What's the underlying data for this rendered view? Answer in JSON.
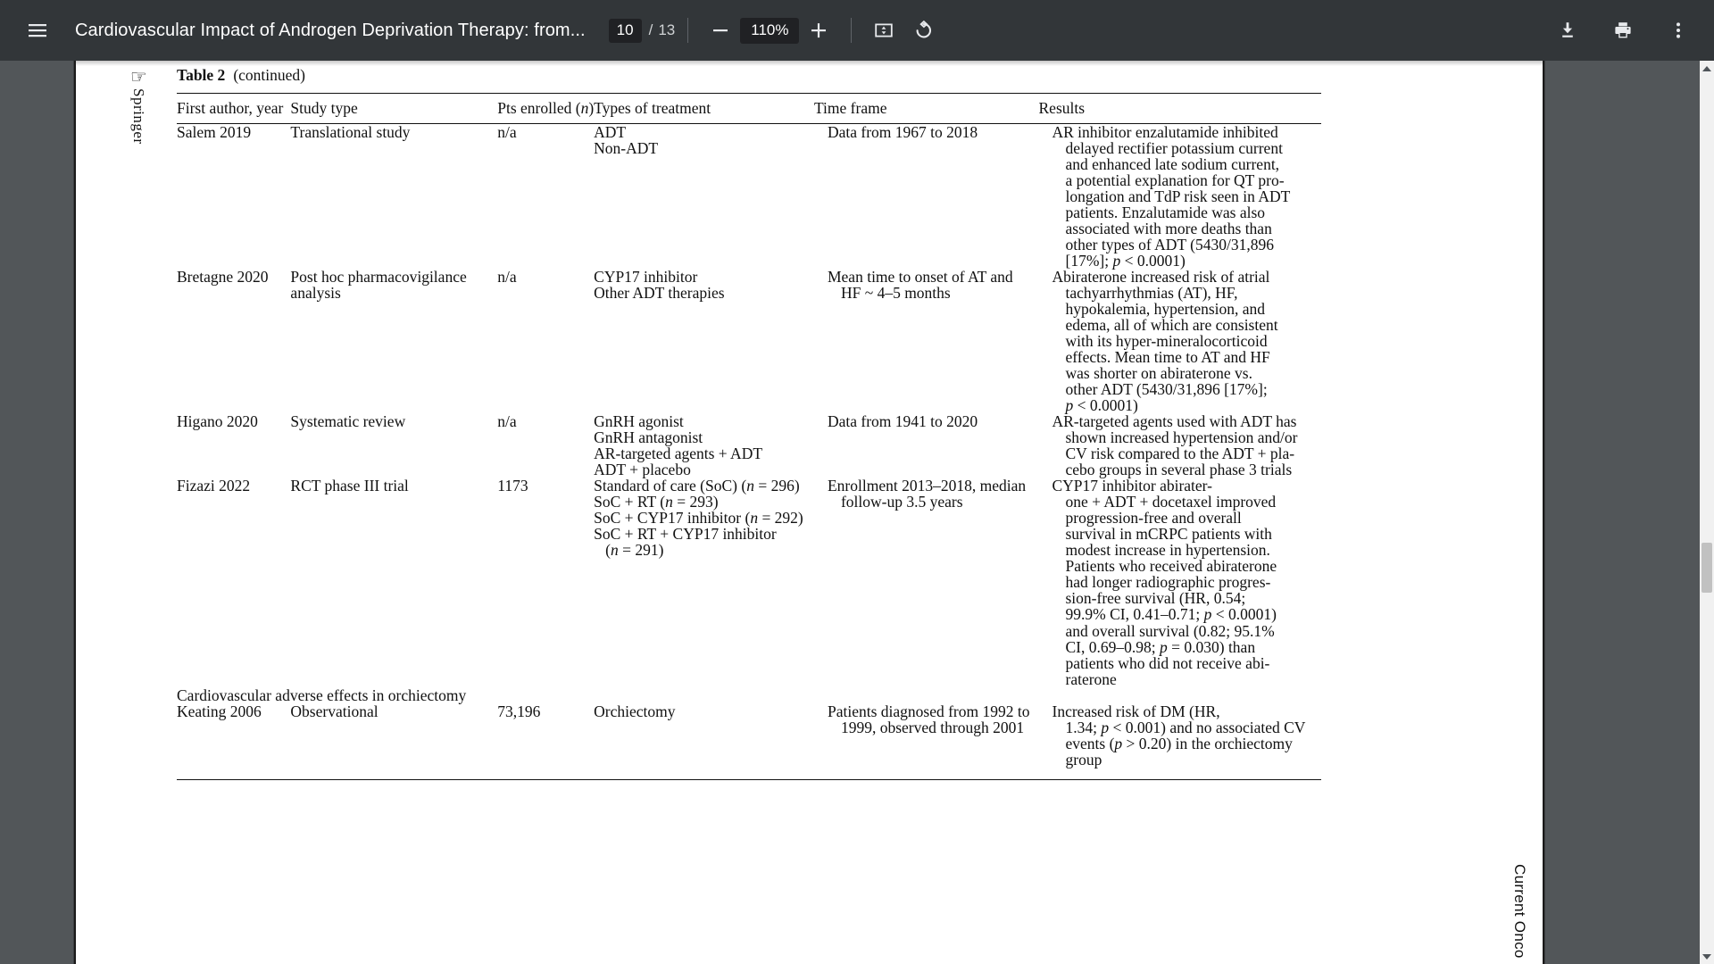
{
  "toolbar": {
    "menu_icon": "hamburger-menu-icon",
    "title": "Cardiovascular Impact of Androgen Deprivation Therapy: from...",
    "page_current": "10",
    "page_separator": "/",
    "page_total": "13",
    "zoom_out_icon": "minus-icon",
    "zoom_value": "110%",
    "zoom_in_icon": "plus-icon",
    "fit_page_icon": "fit-to-page-icon",
    "rotate_icon": "rotate-counterclockwise-icon",
    "download_icon": "download-icon",
    "print_icon": "print-icon",
    "more_icon": "more-vertical-icon"
  },
  "page": {
    "springer_hand_glyph": "☞",
    "springer_word": "Springer",
    "journal_mark": "Current Onco",
    "caption_label": "Table 2",
    "caption_note": "(continued)",
    "headers": [
      "First author, year",
      "Study type",
      "Pts enrolled (n)",
      "Types of treatment",
      "Time frame",
      "Results"
    ],
    "rows": [
      {
        "author": "Salem 2019",
        "study_type": "Translational study",
        "pts": "n/a",
        "treatment": [
          "ADT",
          "Non-ADT"
        ],
        "time_frame": [
          "Data from 1967 to 2018"
        ],
        "results": [
          "AR inhibitor enzalutamide inhibited",
          "delayed rectifier potassium current",
          "and enhanced late sodium current,",
          "a potential explanation for QT pro-",
          "longation and TdP risk seen in ADT",
          "patients. Enzalutamide was also",
          "associated with more deaths than",
          "other types of ADT (5430/31,896",
          "[17%]; p < 0.0001)"
        ]
      },
      {
        "author": "Bretagne 2020",
        "study_type": "Post hoc pharmacovigilance analysis",
        "pts": "n/a",
        "treatment": [
          "CYP17 inhibitor",
          "Other ADT therapies"
        ],
        "time_frame": [
          "Mean time to onset of AT and",
          "HF ~ 4–5 months"
        ],
        "results": [
          "Abiraterone increased risk of atrial",
          "tachyarrhythmias (AT), HF,",
          "hypokalemia, hypertension, and",
          "edema, all of which are consistent",
          "with its hyper-mineralocorticoid",
          "effects. Mean time to AT and HF",
          "was shorter on abiraterone vs.",
          "other ADT (5430/31,896 [17%];",
          "p < 0.0001)"
        ]
      },
      {
        "author": "Higano 2020",
        "study_type": "Systematic review",
        "pts": "n/a",
        "treatment": [
          "GnRH agonist",
          "GnRH antagonist",
          "AR-targeted agents + ADT",
          "ADT + placebo"
        ],
        "time_frame": [
          "Data from 1941 to 2020"
        ],
        "results": [
          "AR-targeted agents used with ADT has",
          "shown increased hypertension and/or",
          "CV risk compared to the ADT + pla-",
          "cebo groups in several phase 3 trials"
        ]
      },
      {
        "author": "Fizazi 2022",
        "study_type": "RCT phase III trial",
        "pts": "1173",
        "treatment": [
          "Standard of care (SoC) (n = 296)",
          "SoC + RT (n = 293)",
          "SoC + CYP17 inhibitor (n = 292)",
          "SoC + RT + CYP17 inhibitor",
          "(n = 291)"
        ],
        "time_frame": [
          "Enrollment 2013–2018, median",
          "follow-up 3.5 years"
        ],
        "results": [
          "CYP17 inhibitor abirater-",
          "one + ADT + docetaxel improved",
          "progression-free and overall",
          "survival in mCRPC patients with",
          "modest increase in hypertension.",
          "Patients who received abiraterone",
          "had longer radiographic progres-",
          "sion-free survival (HR, 0.54;",
          "99.9% CI, 0.41–0.71; p < 0.0001)",
          "and overall survival (0.82; 95.1%",
          "CI, 0.69–0.98; p = 0.030) than",
          "patients who did not receive abi-",
          "raterone"
        ]
      }
    ],
    "section_heading": "Cardiovascular adverse effects in orchiectomy",
    "section_rows": [
      {
        "author": "Keating 2006",
        "study_type": "Observational",
        "pts": "73,196",
        "treatment": [
          "Orchiectomy"
        ],
        "time_frame": [
          "Patients diagnosed from 1992 to",
          "1999, observed through 2001"
        ],
        "results": [
          "Increased risk of DM (HR,",
          "1.34; p < 0.001) and no associated CV",
          "events (p > 0.20) in the orchiectomy",
          "group"
        ]
      }
    ]
  },
  "scrollbar": {
    "up_icon": "scroll-up-arrow-icon",
    "down_icon": "scroll-down-arrow-icon"
  },
  "colors": {
    "toolbar_bg": "#323639",
    "viewer_bg": "#525659",
    "chip_bg": "#202124",
    "page_bg": "#ffffff"
  }
}
